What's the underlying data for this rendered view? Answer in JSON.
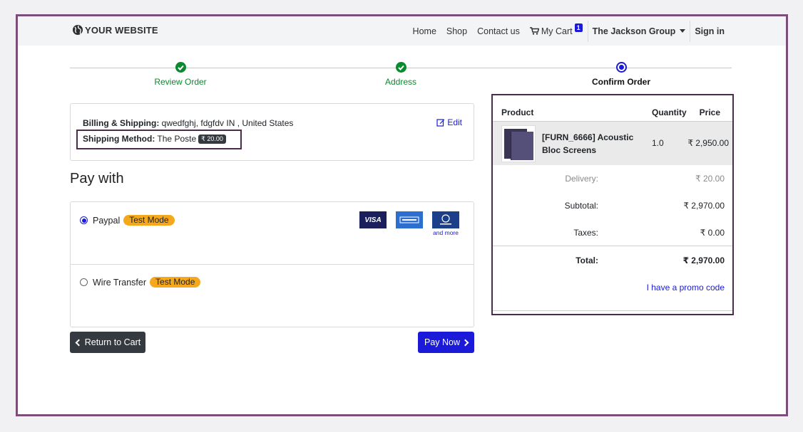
{
  "brand": {
    "name": "YOUR WEBSITE"
  },
  "nav": {
    "home": "Home",
    "shop": "Shop",
    "contact": "Contact us",
    "cart": "My Cart",
    "cart_count": "1",
    "user": "The Jackson Group",
    "signin": "Sign in"
  },
  "steps": [
    {
      "label": "Review Order",
      "state": "done"
    },
    {
      "label": "Address",
      "state": "done"
    },
    {
      "label": "Confirm Order",
      "state": "current"
    }
  ],
  "billing": {
    "billing_label": "Billing & Shipping:",
    "billing_value": " qwedfghj, fdgfdv IN , United States",
    "shipping_label": "Shipping Method:",
    "shipping_value": " The Poste",
    "shipping_price": "₹ 20.00",
    "edit": "Edit"
  },
  "payment": {
    "heading": "Pay with",
    "methods": [
      {
        "name": "Paypal",
        "badge": "Test Mode",
        "selected": true
      },
      {
        "name": "Wire Transfer",
        "badge": "Test Mode",
        "selected": false
      }
    ],
    "card_visa": "VISA",
    "and_more": "and more"
  },
  "buttons": {
    "return": "Return to Cart",
    "paynow": "Pay Now"
  },
  "summary": {
    "col_product": "Product",
    "col_quantity": "Quantity",
    "col_price": "Price",
    "product": {
      "name": "[FURN_6666] Acoustic Bloc Screens",
      "quantity": "1.0",
      "price": "₹ 2,950.00"
    },
    "delivery_label": "Delivery:",
    "delivery_value": "₹ 20.00",
    "subtotal_label": "Subtotal:",
    "subtotal_value": "₹ 2,970.00",
    "taxes_label": "Taxes:",
    "taxes_value": "₹ 0.00",
    "total_label": "Total:",
    "total_value": "₹ 2,970.00",
    "promo": "I have a promo code"
  },
  "colors": {
    "accent": "#1a1ad8",
    "success": "#0a8a2e",
    "badge": "#f5a81c",
    "frame": "#7a4e78"
  }
}
